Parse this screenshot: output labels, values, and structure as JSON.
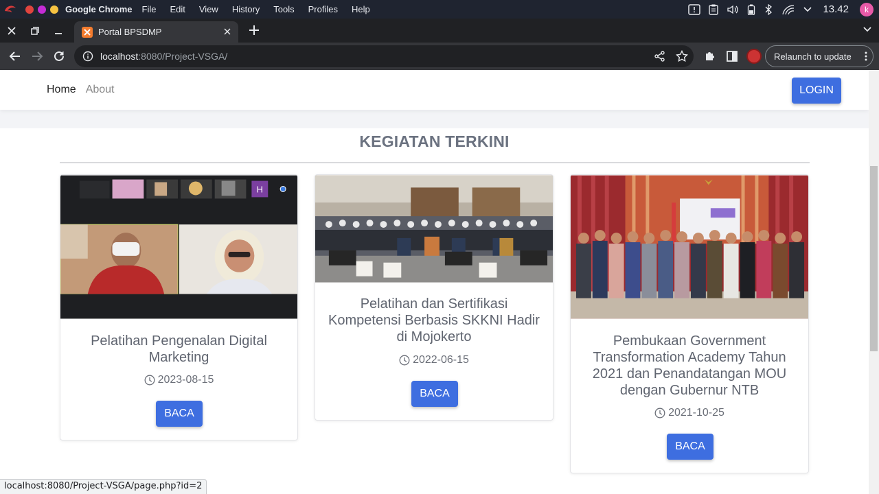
{
  "os": {
    "app_name": "Google Chrome",
    "menu": [
      "File",
      "Edit",
      "View",
      "History",
      "Tools",
      "Profiles",
      "Help"
    ],
    "clock": "13.42",
    "avatar_letter": "k",
    "traffic_colors": [
      "#e0443e",
      "#c42cd6",
      "#f5c242"
    ]
  },
  "browser": {
    "tab_title": "Portal BPSDMP",
    "url_host": "localhost",
    "url_rest": ":8080/Project-VSGA/",
    "relaunch_label": "Relaunch to update",
    "status_url": "localhost:8080/Project-VSGA/page.php?id=2"
  },
  "site": {
    "nav": {
      "home": "Home",
      "about": "About",
      "login": "LOGIN"
    },
    "section_title": "KEGIATAN TERKINI",
    "accent": "#3e6ee0",
    "cards": [
      {
        "title": "Pelatihan Pengenalan Digital Marketing",
        "date": "2023-08-15",
        "button": "BACA",
        "image": "video-conference-photo"
      },
      {
        "title": "Pelatihan dan Sertifikasi Kompetensi Berbasis SKKNI Hadir di Mojokerto",
        "date": "2022-06-15",
        "button": "BACA",
        "image": "group-training-photo"
      },
      {
        "title": "Pembukaan Government Transformation Academy Tahun 2021 dan Penandatangan MOU dengan Gubernur NTB",
        "date": "2021-10-25",
        "button": "BACA",
        "image": "group-ceremony-photo"
      }
    ],
    "thumb_letter": "H"
  }
}
